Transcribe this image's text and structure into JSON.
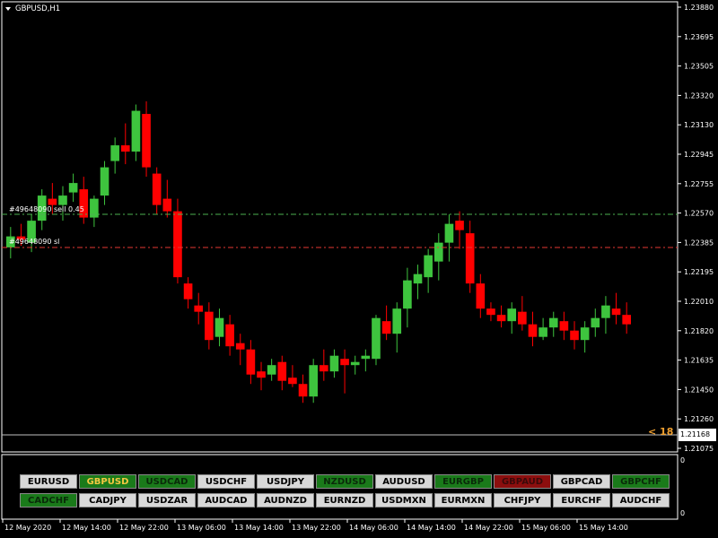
{
  "header": {
    "symbol": "GBPUSD,H1"
  },
  "price_axis": {
    "labels": [
      "1.23880",
      "1.23695",
      "1.23505",
      "1.23320",
      "1.23130",
      "1.22945",
      "1.22755",
      "1.22570",
      "1.22385",
      "1.22195",
      "1.22010",
      "1.21820",
      "1.21635",
      "1.21450",
      "1.21260",
      "1.21075"
    ],
    "current_price": "1.21168",
    "marker_text": "< 18"
  },
  "sub_axis": {
    "top": "0",
    "bottom": "0"
  },
  "time_axis": [
    "12 May 2020",
    "12 May 14:00",
    "12 May 22:00",
    "13 May 06:00",
    "13 May 14:00",
    "13 May 22:00",
    "14 May 06:00",
    "14 May 14:00",
    "14 May 22:00",
    "15 May 06:00",
    "15 May 14:00"
  ],
  "order_lines": [
    {
      "label": "#49648090 sell 0.45",
      "color": "#4caf50"
    },
    {
      "label": "#49648090 sl",
      "color": "#e53935"
    }
  ],
  "colors": {
    "bull": "#3ec43e",
    "bear": "#ff0000",
    "background": "#000000",
    "grid": "#ffffff"
  },
  "symbol_buttons": {
    "row1": [
      {
        "label": "EURUSD",
        "state": "normal"
      },
      {
        "label": "GBPUSD",
        "state": "selected"
      },
      {
        "label": "USDCAD",
        "state": "green"
      },
      {
        "label": "USDCHF",
        "state": "normal"
      },
      {
        "label": "USDJPY",
        "state": "normal"
      },
      {
        "label": "NZDUSD",
        "state": "green"
      },
      {
        "label": "AUDUSD",
        "state": "normal"
      },
      {
        "label": "EURGBP",
        "state": "green"
      },
      {
        "label": "GBPAUD",
        "state": "red"
      },
      {
        "label": "GBPCAD",
        "state": "normal"
      },
      {
        "label": "GBPCHF",
        "state": "green"
      }
    ],
    "row2": [
      {
        "label": "CADCHF",
        "state": "green"
      },
      {
        "label": "CADJPY",
        "state": "normal"
      },
      {
        "label": "USDZAR",
        "state": "normal"
      },
      {
        "label": "AUDCAD",
        "state": "normal"
      },
      {
        "label": "AUDNZD",
        "state": "normal"
      },
      {
        "label": "EURNZD",
        "state": "normal"
      },
      {
        "label": "USDMXN",
        "state": "normal"
      },
      {
        "label": "EURMXN",
        "state": "normal"
      },
      {
        "label": "CHFJPY",
        "state": "normal"
      },
      {
        "label": "EURCHF",
        "state": "normal"
      },
      {
        "label": "AUDCHF",
        "state": "normal"
      }
    ]
  },
  "chart_data": {
    "type": "candlestick",
    "candles": [
      [
        1.2235,
        1.2248,
        1.2228,
        1.2242
      ],
      [
        1.2242,
        1.225,
        1.2236,
        1.224
      ],
      [
        1.2238,
        1.2256,
        1.2232,
        1.2252
      ],
      [
        1.2252,
        1.2272,
        1.2246,
        1.2268
      ],
      [
        1.2266,
        1.2276,
        1.2256,
        1.2262
      ],
      [
        1.2262,
        1.2274,
        1.2252,
        1.2268
      ],
      [
        1.227,
        1.2282,
        1.2264,
        1.2276
      ],
      [
        1.2272,
        1.228,
        1.225,
        1.2254
      ],
      [
        1.2254,
        1.2268,
        1.2248,
        1.2266
      ],
      [
        1.2268,
        1.229,
        1.2262,
        1.2286
      ],
      [
        1.229,
        1.2305,
        1.2282,
        1.23
      ],
      [
        1.23,
        1.2314,
        1.2288,
        1.2296
      ],
      [
        1.2296,
        1.2326,
        1.229,
        1.2322
      ],
      [
        1.232,
        1.2328,
        1.228,
        1.2286
      ],
      [
        1.2282,
        1.2286,
        1.2256,
        1.2262
      ],
      [
        1.2266,
        1.2278,
        1.2254,
        1.2258
      ],
      [
        1.2258,
        1.2266,
        1.2212,
        1.2216
      ],
      [
        1.2212,
        1.2216,
        1.2196,
        1.2202
      ],
      [
        1.2198,
        1.2206,
        1.2186,
        1.2194
      ],
      [
        1.2194,
        1.22,
        1.217,
        1.2176
      ],
      [
        1.2178,
        1.2196,
        1.2172,
        1.219
      ],
      [
        1.2186,
        1.2192,
        1.2166,
        1.2172
      ],
      [
        1.2174,
        1.218,
        1.216,
        1.217
      ],
      [
        1.217,
        1.2176,
        1.2148,
        1.2154
      ],
      [
        1.2156,
        1.2162,
        1.2144,
        1.2152
      ],
      [
        1.2154,
        1.2164,
        1.215,
        1.216
      ],
      [
        1.2162,
        1.2166,
        1.2144,
        1.215
      ],
      [
        1.2152,
        1.216,
        1.2146,
        1.2148
      ],
      [
        1.2148,
        1.2154,
        1.2136,
        1.214
      ],
      [
        1.214,
        1.2164,
        1.2136,
        1.216
      ],
      [
        1.216,
        1.217,
        1.215,
        1.2156
      ],
      [
        1.2156,
        1.217,
        1.2152,
        1.2166
      ],
      [
        1.2164,
        1.217,
        1.2142,
        1.216
      ],
      [
        1.216,
        1.2166,
        1.2154,
        1.2162
      ],
      [
        1.2164,
        1.217,
        1.2156,
        1.2166
      ],
      [
        1.2164,
        1.2192,
        1.216,
        1.219
      ],
      [
        1.2188,
        1.2198,
        1.2176,
        1.218
      ],
      [
        1.218,
        1.22,
        1.2168,
        1.2196
      ],
      [
        1.2196,
        1.2222,
        1.2184,
        1.2214
      ],
      [
        1.2212,
        1.2224,
        1.2202,
        1.2218
      ],
      [
        1.2216,
        1.2234,
        1.2206,
        1.223
      ],
      [
        1.2226,
        1.2244,
        1.2214,
        1.2238
      ],
      [
        1.2238,
        1.2256,
        1.2226,
        1.225
      ],
      [
        1.2252,
        1.2258,
        1.2234,
        1.2246
      ],
      [
        1.2244,
        1.2252,
        1.2206,
        1.2212
      ],
      [
        1.2212,
        1.2218,
        1.219,
        1.2196
      ],
      [
        1.2196,
        1.22,
        1.2188,
        1.2192
      ],
      [
        1.2192,
        1.2198,
        1.2184,
        1.2188
      ],
      [
        1.2188,
        1.22,
        1.218,
        1.2196
      ],
      [
        1.2194,
        1.2204,
        1.2182,
        1.2186
      ],
      [
        1.2186,
        1.2194,
        1.2172,
        1.2178
      ],
      [
        1.2178,
        1.219,
        1.2176,
        1.2184
      ],
      [
        1.2184,
        1.2194,
        1.2178,
        1.219
      ],
      [
        1.2188,
        1.2194,
        1.2176,
        1.2182
      ],
      [
        1.2182,
        1.2188,
        1.217,
        1.2176
      ],
      [
        1.2176,
        1.2188,
        1.2168,
        1.2184
      ],
      [
        1.2184,
        1.2196,
        1.2178,
        1.219
      ],
      [
        1.219,
        1.2204,
        1.218,
        1.2198
      ],
      [
        1.2196,
        1.2206,
        1.2186,
        1.2192
      ],
      [
        1.2192,
        1.22,
        1.218,
        1.2186
      ]
    ]
  }
}
